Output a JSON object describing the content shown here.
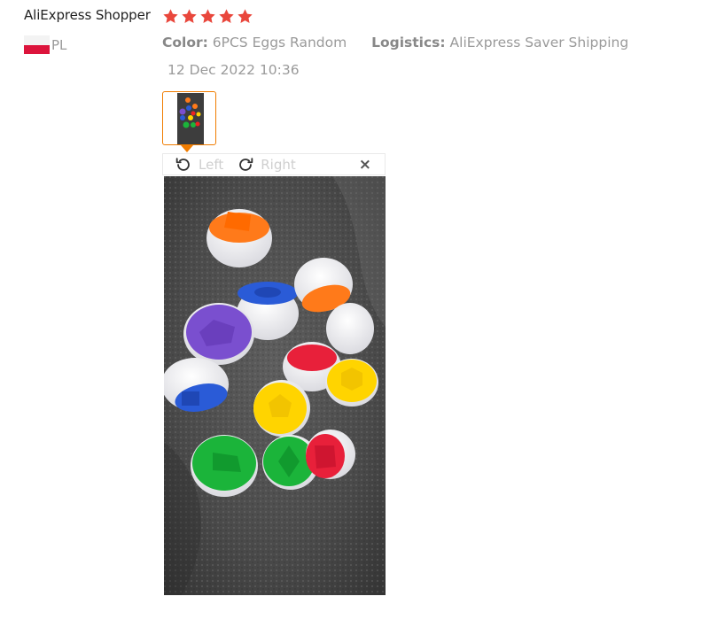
{
  "review": {
    "reviewer_name": "AliExpress Shopper",
    "rating": 5,
    "country_code": "PL",
    "attributes": [
      {
        "key": "Color:",
        "value": "6PCS Eggs Random"
      },
      {
        "key": "Logistics:",
        "value": "AliExpress Saver Shipping"
      }
    ],
    "date": "12 Dec 2022 10:36"
  },
  "viewer": {
    "rotate_left_label": "Left",
    "rotate_right_label": "Right",
    "close_symbol": "×"
  },
  "colors": {
    "star": "#e9473c",
    "accent": "#f07c00",
    "flag_white": "#f3f3f3",
    "flag_red": "#dc143c"
  },
  "icons": [
    "star-icon",
    "flag-icon",
    "rotate-left-icon",
    "rotate-right-icon",
    "close-icon"
  ]
}
